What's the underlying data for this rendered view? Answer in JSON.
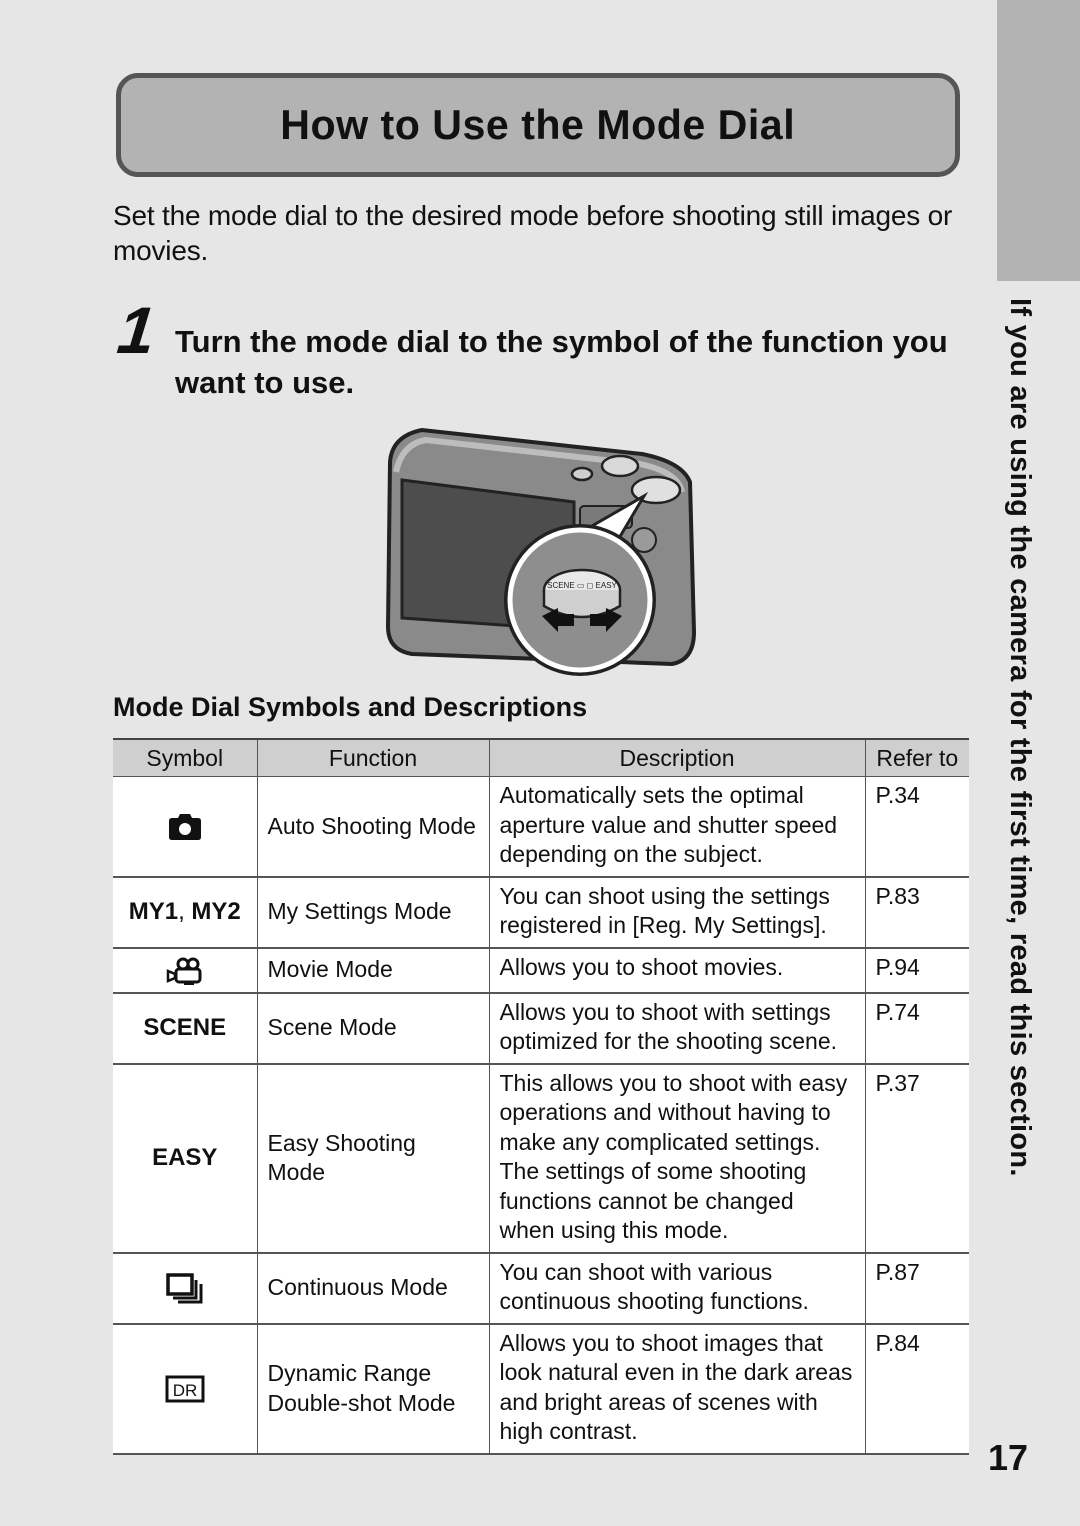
{
  "page": {
    "title": "How to Use the Mode Dial",
    "intro": "Set the mode dial to the desired mode before shooting still images or movies.",
    "step": {
      "number": "1",
      "text": "Turn the mode dial to the symbol of the function you want to use."
    },
    "illustration": "camera-mode-dial-illustration",
    "side_tab_text": "If you are using the camera for the first time, read this section.",
    "page_number": "17"
  },
  "table": {
    "heading": "Mode Dial Symbols and Descriptions",
    "columns": [
      "Symbol",
      "Function",
      "Description",
      "Refer to"
    ],
    "rows": [
      {
        "symbol_icon": "camera-icon",
        "symbol_text": "",
        "function": "Auto Shooting Mode",
        "description": "Automatically sets the optimal aperture value and shutter speed depending on the subject.",
        "refer": "P.34"
      },
      {
        "symbol_icon": "",
        "symbol_text_parts": [
          "MY1",
          ", ",
          "MY2"
        ],
        "function": "My Settings Mode",
        "description": "You can shoot using the settings registered in [Reg. My Settings].",
        "refer": "P.83"
      },
      {
        "symbol_icon": "movie-camera-icon",
        "symbol_text": "",
        "function": "Movie Mode",
        "description": "Allows you to shoot movies.",
        "refer": "P.94"
      },
      {
        "symbol_icon": "",
        "symbol_text": "SCENE",
        "function": "Scene Mode",
        "description": "Allows you to shoot with settings optimized for the shooting scene.",
        "refer": "P.74"
      },
      {
        "symbol_icon": "",
        "symbol_text": "EASY",
        "function": "Easy Shooting Mode",
        "description": "This allows you to shoot with easy operations and without having to make any complicated settings. The settings of some shooting functions cannot be changed when using this mode.",
        "refer": "P.37"
      },
      {
        "symbol_icon": "continuous-mode-icon",
        "symbol_text": "",
        "function": "Continuous Mode",
        "description": "You can shoot with various continuous shooting functions.",
        "refer": "P.87"
      },
      {
        "symbol_icon": "dynamic-range-icon",
        "symbol_text": "DR",
        "function": "Dynamic Range Double-shot Mode",
        "description": "Allows you to shoot images that look natural even in the dark areas and bright areas of scenes with high contrast.",
        "refer": "P.84"
      }
    ]
  }
}
